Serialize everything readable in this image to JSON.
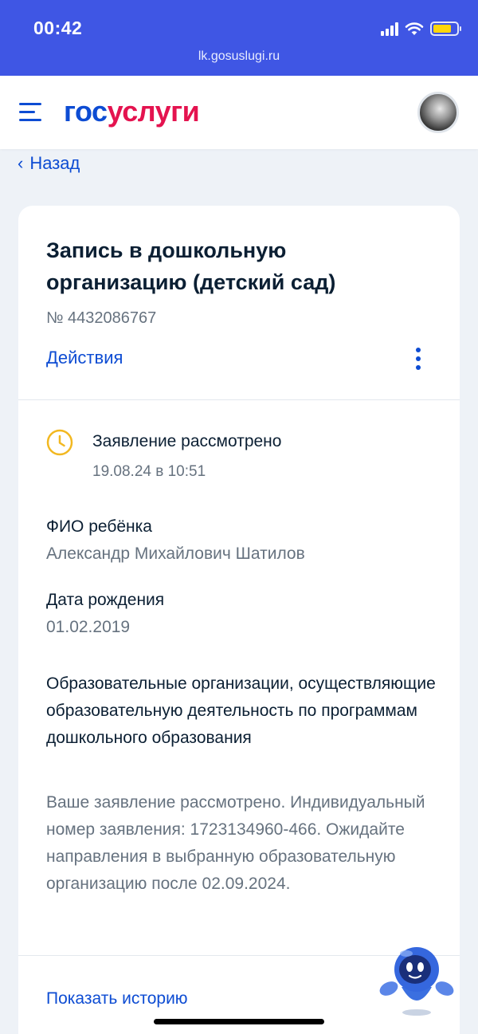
{
  "status_bar": {
    "time": "00:42",
    "url": "lk.gosuslugi.ru",
    "battery_color": "#ffd60a"
  },
  "header": {
    "logo_part1": "гос",
    "logo_part2": "услуги",
    "logo_colors": {
      "part1": "#0d4cd3",
      "part2": "#e4134f"
    },
    "menu_icon": "burger-menu-icon",
    "avatar_icon": "user-avatar"
  },
  "nav": {
    "back_label": "Назад"
  },
  "application": {
    "title": "Запись в дошкольную организацию (детский сад)",
    "number": "№ 4432086767",
    "actions_label": "Действия",
    "status": {
      "icon": "clock-icon",
      "icon_color": "#f2b821",
      "title": "Заявление рассмотрено",
      "date": "19.08.24 в 10:51"
    },
    "fields": [
      {
        "label": "ФИО ребёнка",
        "value": "Александр Михайлович Шатилов"
      },
      {
        "label": "Дата рождения",
        "value": "01.02.2019"
      }
    ],
    "organization": {
      "title": "Образовательные организации, осуществляющие образовательную деятельность по программам дошкольного образования",
      "text": "Ваше заявление рассмотрено. Индивидуальный номер заявления: 1723134960-466. Ожидайте направления в выбранную образовательную организацию после 02.09.2024."
    },
    "history_label": "Показать историю"
  },
  "colors": {
    "accent": "#0d4cd3",
    "status_bar": "#3f56e4",
    "muted_text": "#66727f",
    "background": "#eef2f7"
  }
}
